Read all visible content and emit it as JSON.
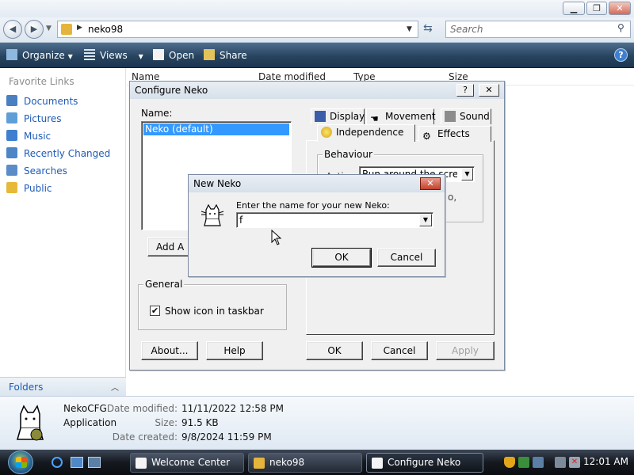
{
  "explorer": {
    "breadcrumb": "neko98",
    "search_placeholder": "Search",
    "toolbar": {
      "organize": "Organize",
      "views": "Views",
      "open": "Open",
      "share": "Share",
      "help": "?"
    },
    "favorite_links_heading": "Favorite Links",
    "favorite_links": [
      {
        "label": "Documents",
        "icon": "documents-icon",
        "color": "#4a7fc1"
      },
      {
        "label": "Pictures",
        "icon": "pictures-icon",
        "color": "#5f9fd8"
      },
      {
        "label": "Music",
        "icon": "music-icon",
        "color": "#3f7fd0"
      },
      {
        "label": "Recently Changed",
        "icon": "recent-icon",
        "color": "#4d86c7"
      },
      {
        "label": "Searches",
        "icon": "searches-icon",
        "color": "#5b8cc8"
      },
      {
        "label": "Public",
        "icon": "public-folder-icon",
        "color": "#e6b93a"
      }
    ],
    "folders_label": "Folders",
    "columns": [
      "Name",
      "Date modified",
      "Type",
      "Size"
    ],
    "details": {
      "name": "NekoCFG",
      "type": "Application",
      "date_modified_label": "Date modified:",
      "date_modified": "11/11/2022 12:58 PM",
      "size_label": "Size:",
      "size": "91.5 KB",
      "date_created_label": "Date created:",
      "date_created": "9/8/2024 11:59 PM"
    }
  },
  "configure": {
    "title": "Configure Neko",
    "help_btn": "?",
    "close_btn": "✕",
    "name_label": "Name:",
    "names": [
      "Neko (default)"
    ],
    "add_button": "Add A N",
    "general_group": "General",
    "show_icon_label": "Show icon in taskbar",
    "show_icon_checked": true,
    "about": "About...",
    "help": "Help",
    "ok": "OK",
    "cancel": "Cancel",
    "apply": "Apply",
    "tabs_top": [
      "Display",
      "Movement",
      "Sound"
    ],
    "tabs_bottom": [
      "Independence",
      "Effects"
    ],
    "behaviour_group": "Behaviour",
    "behaviour_select": "Run around the screen",
    "behaviour_partial_label": "Actio",
    "behaviour_partial_text": "o,"
  },
  "newneko": {
    "title": "New Neko",
    "close_btn": "✕",
    "prompt": "Enter the name for your new Neko:",
    "input_value": "f",
    "ok": "OK",
    "cancel": "Cancel"
  },
  "taskbar": {
    "tasks": [
      "Welcome Center",
      "neko98",
      "Configure Neko"
    ],
    "clock": "12:01 AM"
  }
}
